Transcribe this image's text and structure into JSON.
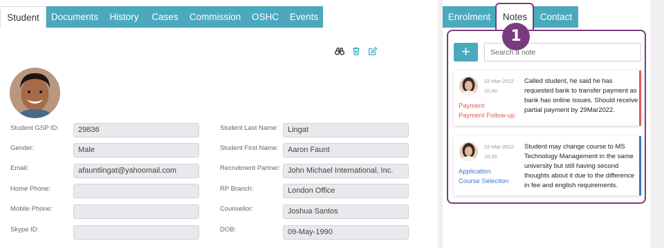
{
  "left_tabs": [
    {
      "label": "Student",
      "active": true
    },
    {
      "label": "Documents"
    },
    {
      "label": "History"
    },
    {
      "label": "Cases"
    },
    {
      "label": "Commission"
    },
    {
      "label": "OSHC"
    },
    {
      "label": "Events"
    }
  ],
  "right_tabs": [
    {
      "label": "Enrolment"
    },
    {
      "label": "Notes",
      "active": true
    },
    {
      "label": "Contact"
    }
  ],
  "action_icons": [
    "binoculars-icon",
    "trash-icon",
    "edit-icon"
  ],
  "colors": {
    "tab_teal": "#4aa9bd",
    "highlight_purple": "#7a3a80",
    "payment_red": "#e05a5a",
    "application_blue": "#3a79c4"
  },
  "student_fields_left": [
    {
      "label": "Student GSP ID:",
      "value": "29836"
    },
    {
      "label": "Gender:",
      "value": "Male"
    },
    {
      "label": "Email:",
      "value": "afauntlingat@yahoomail.com"
    },
    {
      "label": "Home Phone:",
      "value": ""
    },
    {
      "label": "Mobile Phone:",
      "value": ""
    },
    {
      "label": "Skype ID:",
      "value": ""
    }
  ],
  "student_fields_right": [
    {
      "label": "Student Last Name:",
      "value": "Lingat"
    },
    {
      "label": "Student First Name:",
      "value": "Aaron Faunt"
    },
    {
      "label": "Recruitment Partner:",
      "value": "John Michael International, Inc."
    },
    {
      "label": "RP Branch:",
      "value": "London Office"
    },
    {
      "label": "Counsellor:",
      "value": "Joshua Santos"
    },
    {
      "label": "DOB:",
      "value": "09-May-1990"
    }
  ],
  "notes": {
    "step_badge": "1",
    "add_label": "+",
    "search_placeholder": "Search a note",
    "items": [
      {
        "date": "22-Mar-2022",
        "time": "10:40",
        "category": "Payment",
        "subcategory": "Payment Follow-up",
        "text": "Called student, he said he has requested bank to transfer payment as bank has online issues. Should receive partial payment by 29Mar2022."
      },
      {
        "date": "22-Mar-2022",
        "time": "10:36",
        "category": "Application",
        "subcategory": "Course Selection",
        "text": "Student may change course to MS Technology Management in the same university but still having second thoughts about it due to the difference in fee and english requirements."
      }
    ]
  }
}
